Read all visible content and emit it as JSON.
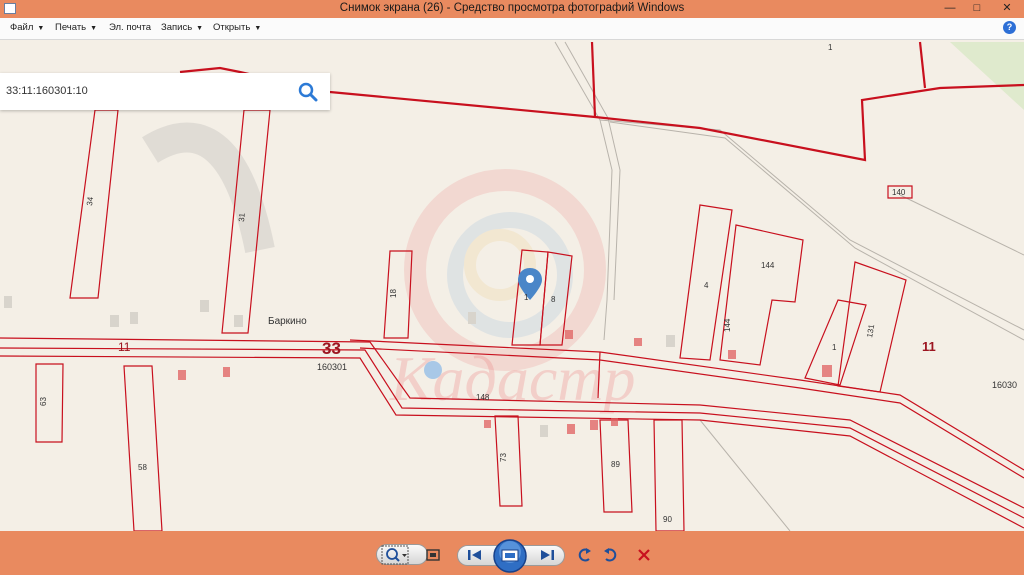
{
  "window": {
    "title": "Снимок экрана (26) - Средство просмотра фотографий Windows",
    "controls": {
      "minimize": "—",
      "maximize": "□",
      "close": "✕"
    }
  },
  "menu": {
    "file": "Файл",
    "print": "Печать",
    "email": "Эл. почта",
    "burn": "Запись",
    "open": "Открыть",
    "help": "?"
  },
  "search": {
    "value": "33:11:160301:10",
    "icon": "search-icon"
  },
  "map": {
    "locality": "Баркино",
    "region": "33",
    "district": "11",
    "district_right": "11",
    "quarter": "160301",
    "quarter_right": "16030",
    "road": "148",
    "parcels": [
      "34",
      "31",
      "18",
      "1",
      "8",
      "4",
      "144",
      "144",
      "1",
      "131",
      "63",
      "58",
      "73",
      "89",
      "90",
      "140",
      "1"
    ],
    "watermark": "Кадастр"
  },
  "toolbar": {
    "icons": [
      "zoom-icon",
      "fit-window-icon",
      "previous-icon",
      "slideshow-icon",
      "next-icon",
      "rotate-ccw-icon",
      "rotate-cw-icon",
      "delete-icon"
    ]
  },
  "colors": {
    "chrome": "#e98a5f",
    "boundary": "#c8101e",
    "map_bg": "#f4efe6",
    "pin": "#4a86c8"
  }
}
